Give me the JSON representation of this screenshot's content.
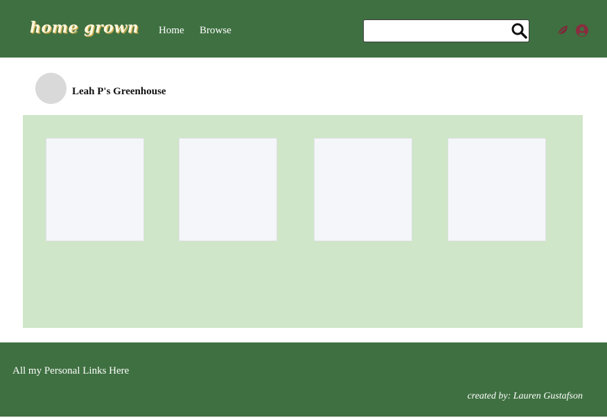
{
  "colors": {
    "header_bg": "#3f7041",
    "panel_bg": "#cfe6c8",
    "card_bg": "#f5f6f9",
    "avatar_bg": "#d9d9d9",
    "leaf_icon": "#7a2b3a",
    "user_icon": "#8a2c3f"
  },
  "header": {
    "logo_text": "home grown",
    "nav": [
      {
        "label": "Home"
      },
      {
        "label": "Browse"
      }
    ],
    "search": {
      "value": "",
      "icon": "search-icon"
    },
    "icons": [
      "leaf-icon",
      "user-icon"
    ]
  },
  "profile": {
    "name": "Leah P's Greenhouse",
    "avatar": "avatar"
  },
  "greenhouse": {
    "cards": [
      {},
      {},
      {},
      {}
    ]
  },
  "footer": {
    "links_text": "All my Personal Links Here",
    "credit_text": "created by: Lauren Gustafson"
  }
}
